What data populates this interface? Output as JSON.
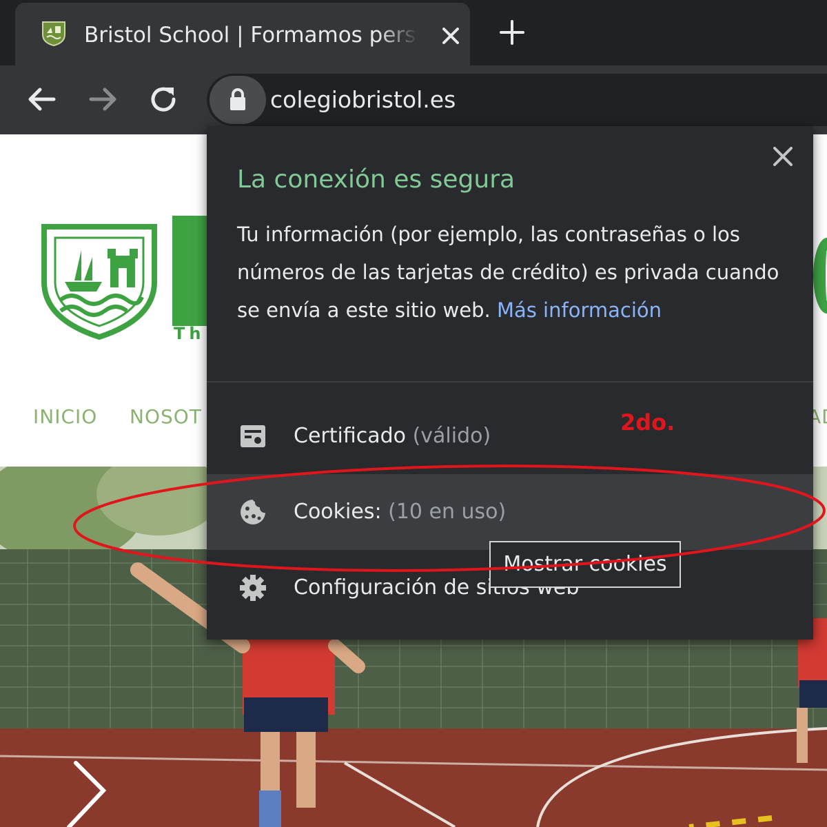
{
  "browser": {
    "tab": {
      "title": "Bristol School | Formamos personas",
      "favicon": "school-crest-icon",
      "close_icon": "close-icon"
    },
    "new_tab_icon": "plus-icon",
    "toolbar": {
      "back_icon": "arrow-left-icon",
      "forward_icon": "arrow-right-icon",
      "reload_icon": "reload-icon",
      "lock_icon": "lock-icon",
      "url": "colegiobristol.es"
    }
  },
  "page": {
    "brand_tagline": "Th",
    "nav": [
      "INICIO",
      "NOSOT",
      "AD"
    ]
  },
  "site_info_popup": {
    "title": "La conexión es segura",
    "body": "Tu información (por ejemplo, las contraseñas o los números de las tarjetas de crédito) es privada cuando se envía a este sitio web.",
    "more_info_link": "Más información",
    "close_icon": "close-icon",
    "rows": [
      {
        "icon": "certificate-icon",
        "label": "Certificado",
        "sublabel": "(válido)"
      },
      {
        "icon": "cookie-icon",
        "label": "Cookies:",
        "sublabel": "(10 en uso)",
        "hovered": true
      },
      {
        "icon": "gear-icon",
        "label": "Configuración de sitios web",
        "sublabel": ""
      }
    ],
    "tooltip": "Mostrar cookies"
  },
  "annotation": {
    "text": "2do.",
    "color": "#e0161c"
  },
  "colors": {
    "chrome_dark": "#202124",
    "chrome_toolbar": "#35363a",
    "popup_bg": "#292a2d",
    "secure_green": "#81c995",
    "link_blue": "#8ab4f8",
    "brand_green": "#3ea243"
  }
}
